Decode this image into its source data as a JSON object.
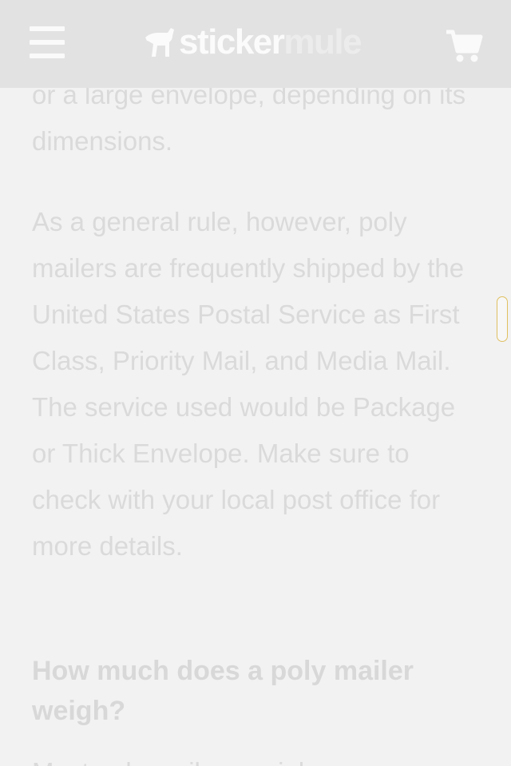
{
  "header": {
    "logo_primary": "sticker",
    "logo_secondary": "mule",
    "menu_icon": "hamburger-menu-icon",
    "cart_icon": "shopping-cart-icon",
    "logo_icon": "mule-logo-icon"
  },
  "article": {
    "para1": "or a large envelope, depending on its dimensions.",
    "para2": "As a general rule, however, poly mailers are frequently shipped by the United States Postal Service as First Class, Priority Mail, and Media Mail. The service used would be Package or Thick Envelope. Make sure to check with your local post office for more details.",
    "heading": "How much does a poly mailer weigh?",
    "para3": "Most poly mailers weigh"
  },
  "colors": {
    "header_bg": "#e2e2e2",
    "page_bg": "#f2f2f2",
    "text": "#dadada"
  }
}
